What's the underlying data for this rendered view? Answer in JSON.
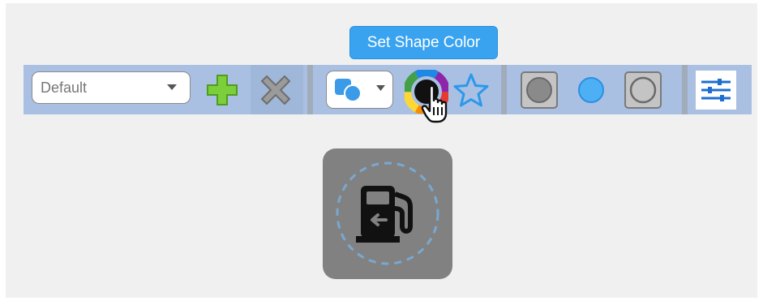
{
  "tooltip": {
    "text": "Set Shape Color"
  },
  "toolbar": {
    "style_select": {
      "value": "Default"
    },
    "icons": {
      "add": "plus-icon",
      "delete": "x-icon",
      "shape_select": "shapes-icon",
      "color": "color-wheel-icon",
      "star": "star-icon",
      "fill_gray": "filled-square-icon",
      "circle": "circle-icon",
      "outline": "outlined-square-icon",
      "settings": "sliders-icon"
    }
  },
  "preview": {
    "icon": "gas-station-icon"
  },
  "colors": {
    "toolbar_bg": "#a9c0e2",
    "accent": "#3aa3ef",
    "add_green": "#7ccf3a",
    "preview_bg": "#818181"
  }
}
